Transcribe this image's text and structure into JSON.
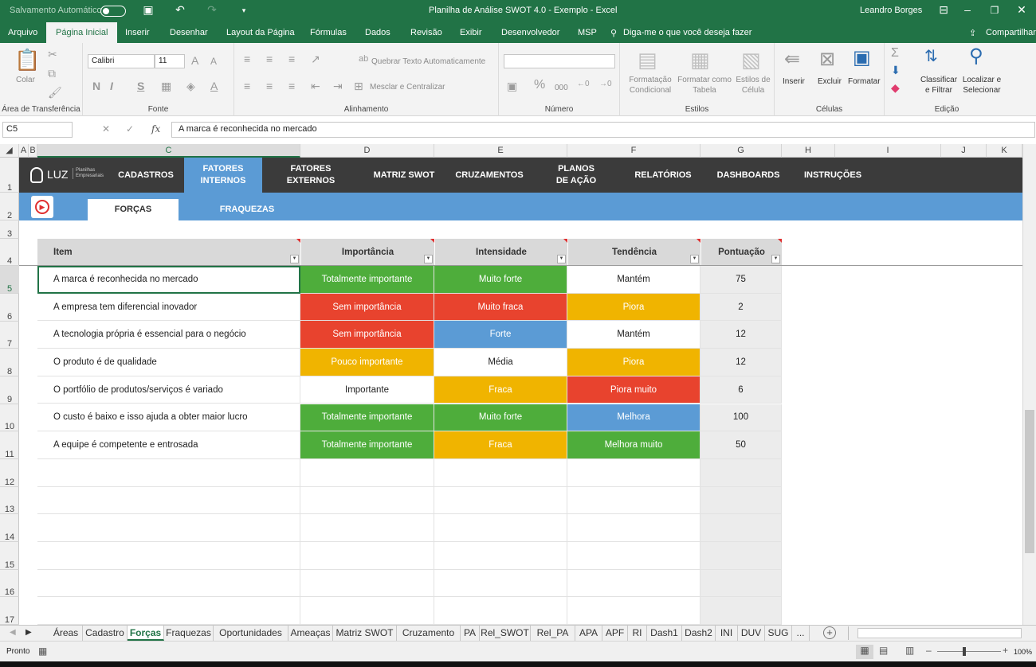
{
  "titlebar": {
    "autosave": "Salvamento Automático",
    "title": "Planilha de Análise SWOT 4.0 - Exemplo  -  Excel",
    "user": "Leandro Borges"
  },
  "ribbon_tabs": [
    "Arquivo",
    "Página Inicial",
    "Inserir",
    "Desenhar",
    "Layout da Página",
    "Fórmulas",
    "Dados",
    "Revisão",
    "Exibir",
    "Desenvolvedor",
    "MSP"
  ],
  "tell_me": "Diga-me o que você deseja fazer",
  "share": "Compartilhar",
  "ribbon": {
    "colar": "Colar",
    "font_name": "Calibri",
    "font_size": "11",
    "wrap_text": "Quebrar Texto Automaticamente",
    "merge_center": "Mesclar e Centralizar",
    "percent": "%",
    "thousands": "000",
    "cond_format": "Formatação Condicional",
    "format_table": "Formatar como Tabela",
    "cell_styles": "Estilos de Célula",
    "insert": "Inserir",
    "delete": "Excluir",
    "format": "Formatar",
    "sort_filter": "Classificar e Filtrar",
    "find_select": "Localizar e Selecionar",
    "groups": [
      "Área de Transferência",
      "Fonte",
      "Alinhamento",
      "Número",
      "Estilos",
      "Células",
      "Edição"
    ]
  },
  "formula_bar": {
    "name_box": "C5",
    "fx": "fx",
    "content": "A marca é reconhecida no mercado"
  },
  "columns": [
    "A",
    "B",
    "C",
    "D",
    "E",
    "F",
    "G",
    "H",
    "I",
    "J",
    "K"
  ],
  "rows": [
    "1",
    "2",
    "3",
    "4",
    "5",
    "6",
    "7",
    "8",
    "9",
    "10",
    "11",
    "12",
    "13",
    "14",
    "15",
    "16",
    "17"
  ],
  "sheet_nav": {
    "logo": "LUZ",
    "logo_sub": "Planilhas Empresariais",
    "items": [
      "CADASTROS",
      "FATORES INTERNOS",
      "FATORES EXTERNOS",
      "MATRIZ SWOT",
      "CRUZAMENTOS",
      "PLANOS DE AÇÃO",
      "RELATÓRIOS",
      "DASHBOARDS",
      "INSTRUÇÕES"
    ],
    "sub_items": [
      "FORÇAS",
      "FRAQUEZAS"
    ]
  },
  "table": {
    "headers": [
      "Item",
      "Importância",
      "Intensidade",
      "Tendência",
      "Pontuação"
    ],
    "rows": [
      {
        "item": "A marca é reconhecida no mercado",
        "importancia": "Totalmente importante",
        "intensidade": "Muito forte",
        "tendencia": "Mantém",
        "pontuacao": "75"
      },
      {
        "item": "A empresa tem diferencial inovador",
        "importancia": "Sem importância",
        "intensidade": "Muito fraca",
        "tendencia": "Piora",
        "pontuacao": "2"
      },
      {
        "item": "A tecnologia própria é essencial para o negócio",
        "importancia": "Sem importância",
        "intensidade": "Forte",
        "tendencia": "Mantém",
        "pontuacao": "12"
      },
      {
        "item": "O produto é de qualidade",
        "importancia": "Pouco importante",
        "intensidade": "Média",
        "tendencia": "Piora",
        "pontuacao": "12"
      },
      {
        "item": "O portfólio de produtos/serviços é variado",
        "importancia": "Importante",
        "intensidade": "Fraca",
        "tendencia": "Piora muito",
        "pontuacao": "6"
      },
      {
        "item": "O custo é baixo e isso ajuda a obter maior lucro",
        "importancia": "Totalmente importante",
        "intensidade": "Muito forte",
        "tendencia": "Melhora",
        "pontuacao": "100"
      },
      {
        "item": "A equipe é competente e entrosada",
        "importancia": "Totalmente importante",
        "intensidade": "Fraca",
        "tendencia": "Melhora muito",
        "pontuacao": "50"
      }
    ]
  },
  "colors": {
    "green": "#4ead3b",
    "red": "#e8432e",
    "orange": "#f0b400",
    "blue": "#5b9bd5",
    "excel_green": "#217346"
  },
  "sheet_tabs": [
    "Áreas",
    "Cadastro",
    "Forças",
    "Fraquezas",
    "Oportunidades",
    "Ameaças",
    "Matriz SWOT",
    "Cruzamento",
    "PA",
    "Rel_SWOT",
    "Rel_PA",
    "APA",
    "APF",
    "RI",
    "Dash1",
    "Dash2",
    "INI",
    "DUV",
    "SUG",
    "..."
  ],
  "active_sheet": "Forças",
  "status": {
    "ready": "Pronto",
    "zoom": "100%"
  }
}
